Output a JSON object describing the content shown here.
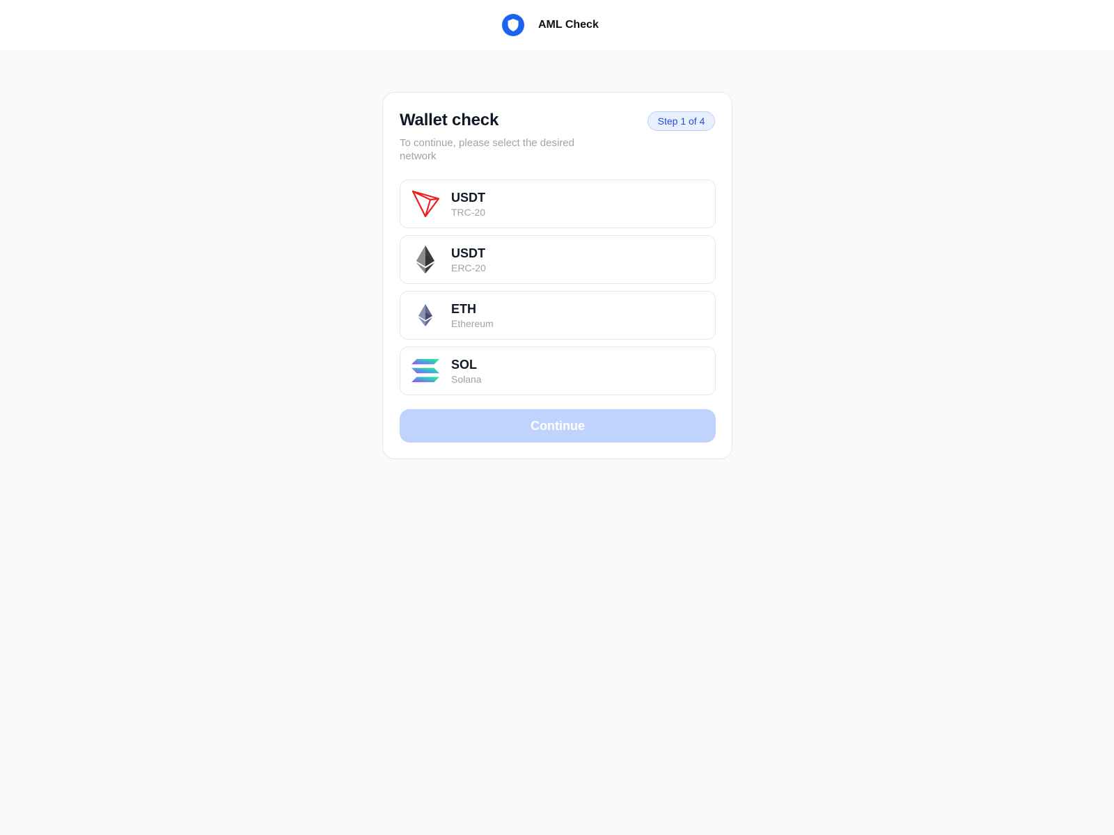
{
  "header": {
    "title": "AML Check",
    "logo_icon": "shield-icon",
    "brand_color": "#1e63f0"
  },
  "card": {
    "title": "Wallet check",
    "subtitle": "To continue, please select the desired network",
    "step_badge": "Step 1 of 4"
  },
  "networks": [
    {
      "name": "USDT",
      "sub": "TRC-20",
      "icon": "tron-icon"
    },
    {
      "name": "USDT",
      "sub": "ERC-20",
      "icon": "ethereum-dark-icon"
    },
    {
      "name": "ETH",
      "sub": "Ethereum",
      "icon": "ethereum-icon"
    },
    {
      "name": "SOL",
      "sub": "Solana",
      "icon": "solana-icon"
    }
  ],
  "actions": {
    "continue_label": "Continue",
    "continue_color": "#bfd3fc"
  }
}
